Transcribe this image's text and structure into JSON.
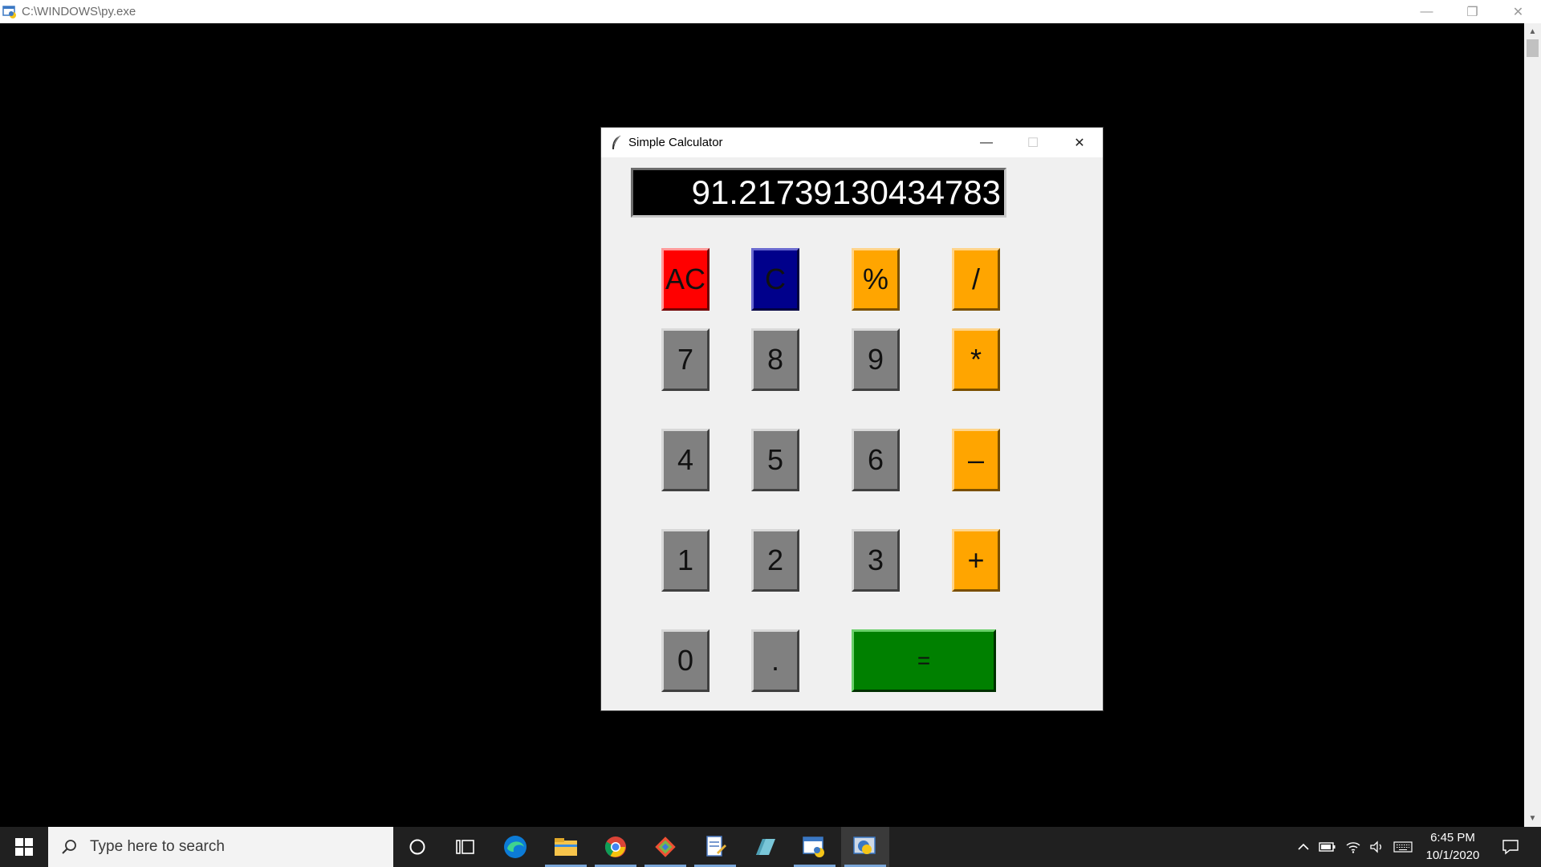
{
  "console": {
    "title": "C:\\WINDOWS\\py.exe",
    "controls": {
      "minimize": "—",
      "restore": "❐",
      "close": "✕"
    }
  },
  "calculator": {
    "title": "Simple Calculator",
    "controls": {
      "minimize": "—",
      "maximize": "☐",
      "close": "✕"
    },
    "display_value": "91.21739130434783",
    "keys": {
      "ac": "AC",
      "c": "C",
      "percent": "%",
      "divide": "/",
      "seven": "7",
      "eight": "8",
      "nine": "9",
      "multiply": "*",
      "four": "4",
      "five": "5",
      "six": "6",
      "subtract": "–",
      "one": "1",
      "two": "2",
      "three": "3",
      "add": "+",
      "zero": "0",
      "dot": ".",
      "equals": "="
    },
    "colors": {
      "digit": "#808080",
      "operator": "#ffa500",
      "all_clear": "#ff0000",
      "clear": "#00008b",
      "equals": "#008000",
      "display_bg": "#000000",
      "display_text": "#ffffff"
    }
  },
  "taskbar": {
    "search_placeholder": "Type here to search",
    "apps": [
      "cortana-icon",
      "task-view-icon",
      "edge-icon",
      "file-explorer-icon",
      "chrome-icon",
      "git-icon",
      "notepad-icon",
      "generic-app-icon",
      "python-launcher-icon",
      "python-idle-icon"
    ],
    "clock": {
      "time": "6:45 PM",
      "date": "10/1/2020"
    }
  }
}
